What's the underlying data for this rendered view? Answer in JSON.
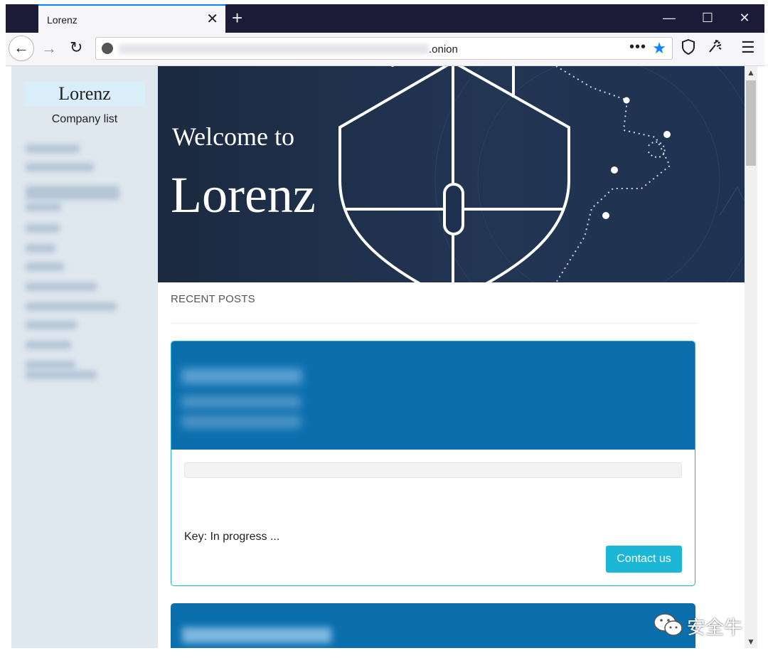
{
  "browser": {
    "tab_title": "Lorenz",
    "tab_close": "✕",
    "new_tab": "+",
    "window_minimize": "—",
    "window_maximize": "☐",
    "window_close": "✕",
    "nav": {
      "back": "←",
      "forward": "→",
      "reload": "↻",
      "menu": "☰"
    },
    "url_visible": ".onion",
    "url_menu": "•••"
  },
  "sidebar": {
    "brand": "Lorenz",
    "company_list_label": "Company list"
  },
  "hero": {
    "welcome": "Welcome to",
    "name": "Lorenz"
  },
  "main": {
    "section_title": "RECENT POSTS",
    "cards": [
      {
        "key_status": "Key: In progress ...",
        "contact_label": "Contact us"
      }
    ]
  },
  "watermark": {
    "text": "安全牛"
  },
  "colors": {
    "tabbar": "#1c1b37",
    "card_header": "#0b6fae",
    "accent": "#1cb6d6",
    "star": "#0a84ff"
  },
  "icons": [
    "back-arrow-icon",
    "forward-arrow-icon",
    "reload-icon",
    "onion-icon",
    "more-icon",
    "bookmark-star-icon",
    "shield-icon",
    "extension-icon",
    "hamburger-menu-icon",
    "wechat-icon"
  ]
}
